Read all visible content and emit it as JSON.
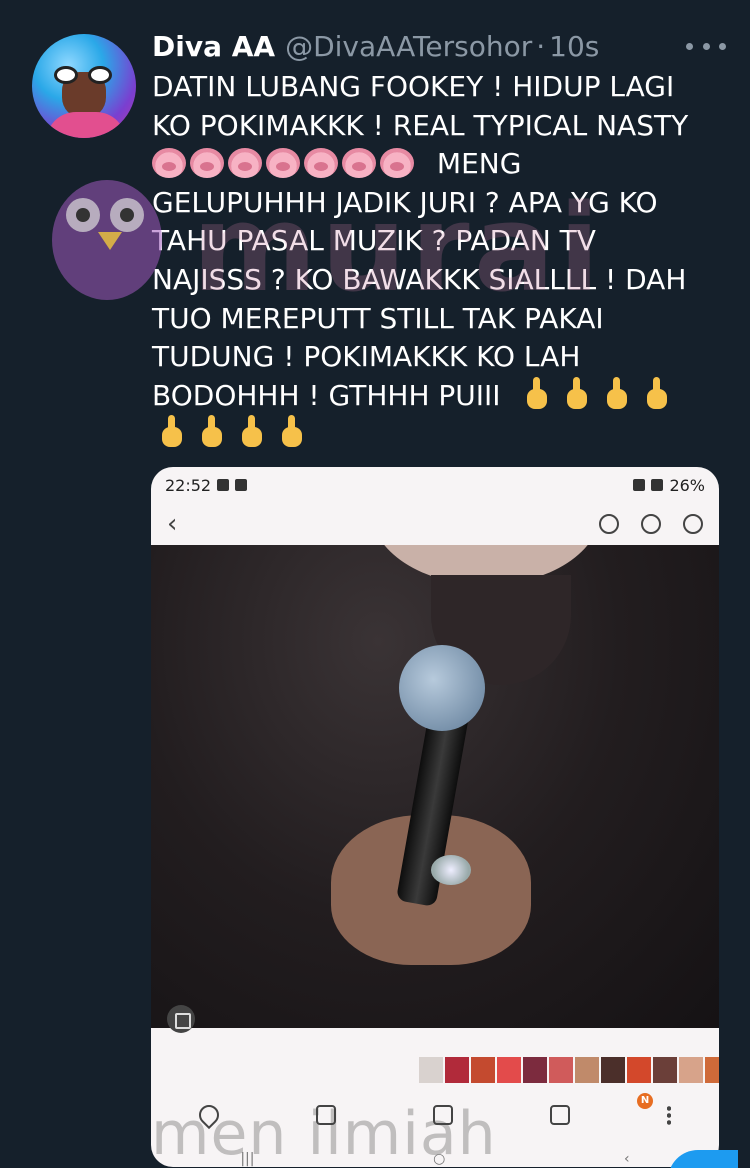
{
  "author": {
    "name": "Diva AA",
    "handle": "@DivaAATersohor",
    "separator": "·",
    "time": "10s"
  },
  "icons": {
    "more": "more-horizontal-icon",
    "avatar": "profile-avatar",
    "pig_emoji": "pig-face-emoji",
    "finger_emoji": "middle-finger-emoji"
  },
  "tweet": {
    "line1": "DATIN LUBANG FOOKEY ! HIDUP LAGI",
    "line2": "KO POKIMAKKK ! REAL TYPICAL NASTY",
    "line3_text": "MENG",
    "line3_pig_count": 7,
    "line4": "GELUPUHHH JADIK JURI ? APA YG KO",
    "line5": "TAHU PASAL MUZIK ? PADAN TV",
    "line6": "NAJISSS ? KO  BAWAKKK SIALLLL ! DAH",
    "line7": "TUO MEREPUTT STILL TAK PAKAI",
    "line8": "TUDUNG ! POKIMAKKK KO LAH",
    "line9_text": "BODOHHH ! GTHHH PUIII",
    "line9_finger_count": 4,
    "line10_finger_count": 4
  },
  "watermark": {
    "brand": "murai",
    "bottom_text": "men ilmiah"
  },
  "media": {
    "status_time": "22:52",
    "battery": "26%",
    "thumbnail_colors": [
      "#d9d2cf",
      "#b12a3a",
      "#c44a2f",
      "#e34b4b",
      "#7c2b3e",
      "#d05b5b",
      "#c08a6a",
      "#4b2f2a",
      "#d3482b",
      "#6b3f39",
      "#d7a38a",
      "#cf6a39",
      "#9c8070",
      "#5e4a46",
      "#b94040",
      "#d78b3b"
    ],
    "badge": "N"
  },
  "colors": {
    "background": "#15202b",
    "text": "#ffffff",
    "secondary": "#8b98a5",
    "accent": "#1d9bf0"
  }
}
